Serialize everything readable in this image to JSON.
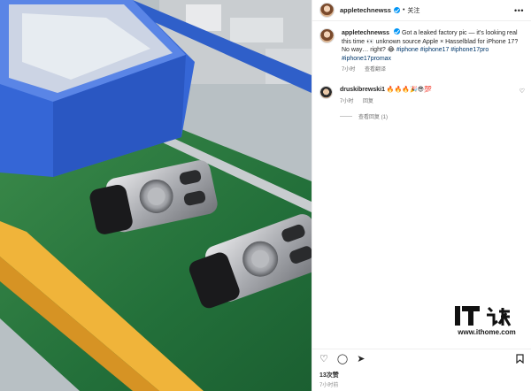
{
  "photo": {
    "description_icon": "photo-icon"
  },
  "header": {
    "username": "appletechnewss",
    "separator": "•",
    "follow_label": "关注",
    "more_icon": "•••"
  },
  "caption": {
    "username": "appletechnewss",
    "text_1": "Got a leaked factory pic — it’s looking real this time 👀 unknown source",
    "text_2": "Apple × Hasselblad for iPhone 17? No way… right? 😂",
    "hashtags": [
      "#iphone",
      "#iphone17",
      "#iphone17pro",
      "#iphone17promax"
    ],
    "time": "7小时",
    "translate_label": "查看翻译"
  },
  "comment": {
    "username": "druskibrewski1",
    "text": "🔥🔥🔥🎉😎💯",
    "time": "7小时",
    "reply_label": "回复",
    "view_replies_label": "查看回复 (1)"
  },
  "actions": {
    "likes": "13次赞",
    "time_ago": "7小时前"
  },
  "watermark": {
    "brand": "IT之家",
    "url": "www.ithome.com"
  },
  "colors": {
    "verified": "#0095f6",
    "hashtag": "#00376b",
    "belt_green": "#2c7a3e",
    "bin_blue": "#3566d6",
    "rail_yellow": "#f0b43a"
  }
}
